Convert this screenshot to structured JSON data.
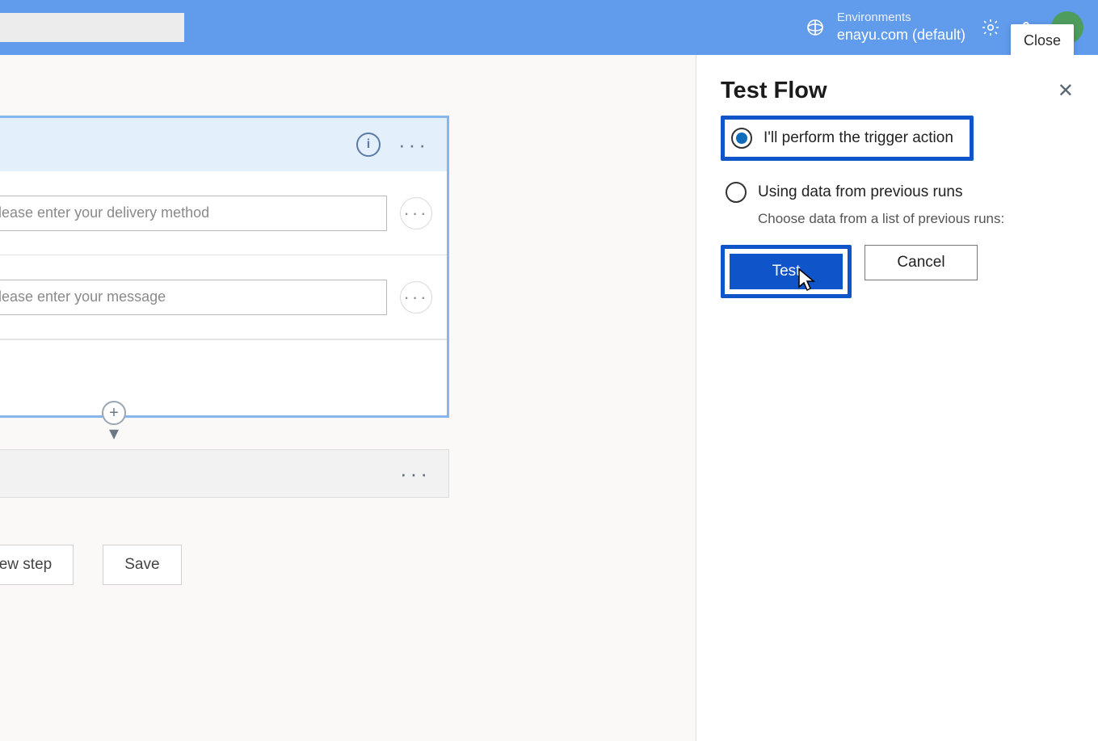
{
  "header": {
    "environments_label": "Environments",
    "environment_name": "enayu.com (default)",
    "close_tooltip": "Close"
  },
  "trigger": {
    "fields": [
      {
        "placeholder": "Please enter your delivery method",
        "value": ""
      },
      {
        "placeholder": "Please enter your message",
        "value": ""
      }
    ]
  },
  "canvas_buttons": {
    "new_step": "New step",
    "save": "Save"
  },
  "panel": {
    "title": "Test Flow",
    "option_trigger": "I'll perform the trigger action",
    "option_previous": "Using data from previous runs",
    "option_previous_sub": "Choose data from a list of previous runs:",
    "test": "Test",
    "cancel": "Cancel"
  }
}
